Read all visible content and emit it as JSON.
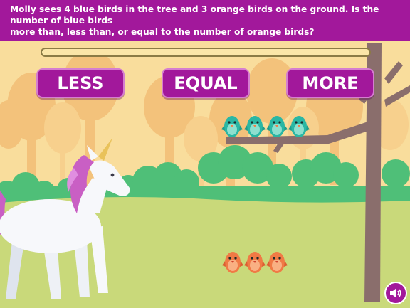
{
  "question": {
    "line1": "Molly sees 4 blue birds in the tree and 3 orange birds on the ground. Is the number of blue birds",
    "line2": "more than, less than, or equal to the number of orange birds?"
  },
  "progress": {
    "fraction": 0.0
  },
  "answers": {
    "less": "LESS",
    "equal": "EQUAL",
    "more": "MORE"
  },
  "scene": {
    "blue_bird_count": 4,
    "orange_bird_count": 3
  },
  "colors": {
    "accent": "#a2189b",
    "sky": "#f9dd9c",
    "grass": "#c9d97a",
    "bush": "#4fbf78",
    "blue_bird": "#2ab7a4",
    "orange_bird": "#f07a45",
    "trunk": "#8a6e6c"
  },
  "icons": {
    "sound": "speaker-icon"
  }
}
